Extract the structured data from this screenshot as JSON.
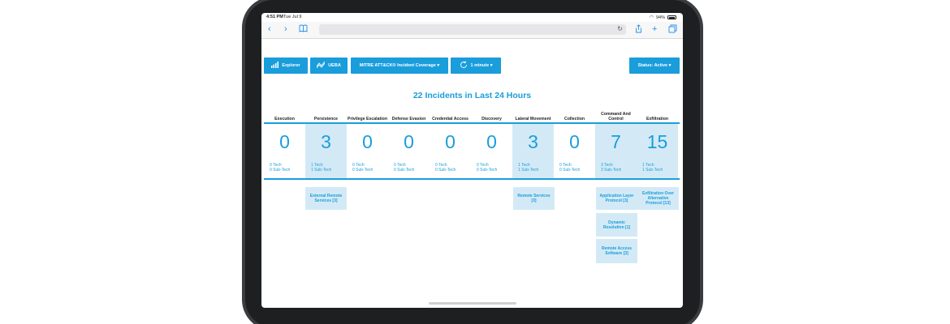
{
  "status_bar": {
    "time": "4:51 PM",
    "date": "Tue Jul 9",
    "battery": "94%"
  },
  "toolbar": {
    "explorer_label": "Explorer",
    "ueba_label": "UEBA",
    "coverage_label": "MITRE ATT&CK® Incident Coverage ▾",
    "interval_label": "1 minute ▾",
    "status_label": "Status: Active ▾"
  },
  "summary": {
    "title": "22 Incidents in Last 24 Hours"
  },
  "columns": [
    {
      "name": "Execution",
      "count": "0",
      "tech": "0 Tech",
      "subtech": "0 Sub-Tech"
    },
    {
      "name": "Persistence",
      "count": "3",
      "tech": "1 Tech",
      "subtech": "1 Sub-Tech"
    },
    {
      "name": "Privilege Escalation",
      "count": "0",
      "tech": "0 Tech",
      "subtech": "0 Sub-Tech"
    },
    {
      "name": "Defense Evasion",
      "count": "0",
      "tech": "0 Tech",
      "subtech": "0 Sub-Tech"
    },
    {
      "name": "Credential Access",
      "count": "0",
      "tech": "0 Tech",
      "subtech": "0 Sub-Tech"
    },
    {
      "name": "Discovery",
      "count": "0",
      "tech": "0 Tech",
      "subtech": "0 Sub-Tech"
    },
    {
      "name": "Lateral Movement",
      "count": "3",
      "tech": "1 Tech",
      "subtech": "1 Sub-Tech"
    },
    {
      "name": "Collection",
      "count": "0",
      "tech": "0 Tech",
      "subtech": "0 Sub-Tech"
    },
    {
      "name": "Command And Control",
      "count": "7",
      "tech": "3 Tech",
      "subtech": "3 Sub-Tech"
    },
    {
      "name": "Exfiltration",
      "count": "15",
      "tech": "1 Tech",
      "subtech": "1 Sub-Tech"
    }
  ],
  "techniques": {
    "persistence": [
      "External Remote Services [3]"
    ],
    "lateral_movement": [
      "Remote Services [3]"
    ],
    "command_and_control": [
      "Application Layer Protocol [3]",
      "Dynamic Resolution [1]",
      "Remote Access Software [3]"
    ],
    "exfiltration": [
      "Exfiltration Over Alternative Protocol [13]"
    ]
  },
  "colors": {
    "accent": "#1a9ddb",
    "highlight": "#d3eaf6",
    "bezel": "#1d1f21"
  }
}
